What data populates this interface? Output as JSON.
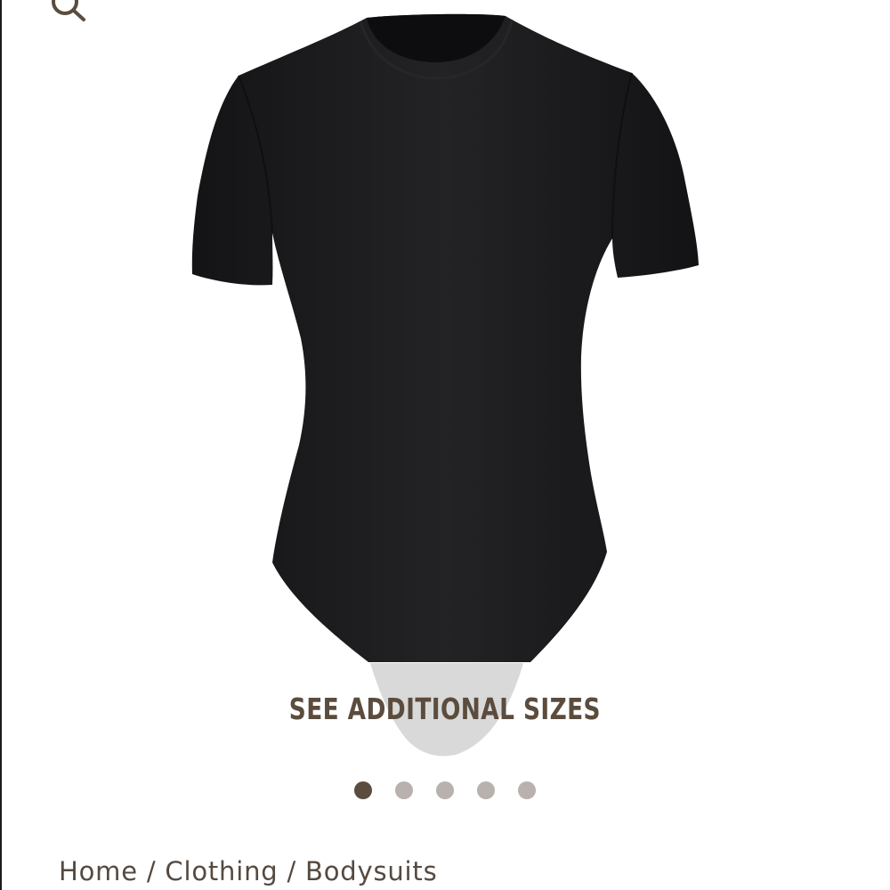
{
  "colors": {
    "accent_text": "#5b4c3e",
    "dot_active": "#5b4c3e",
    "dot_inactive": "#b8b1ad",
    "garment": "#1c1c1e",
    "overlay_band": "#d9d9d9"
  },
  "header": {
    "search_icon": "search-icon"
  },
  "product": {
    "image_alt": "Black short-sleeve bodysuit",
    "additional_sizes_label": "SEE ADDITIONAL SIZES"
  },
  "carousel": {
    "total": 5,
    "active_index": 0
  },
  "breadcrumb": {
    "items": [
      "Home",
      "Clothing",
      "Bodysuits"
    ],
    "separator": "/"
  }
}
